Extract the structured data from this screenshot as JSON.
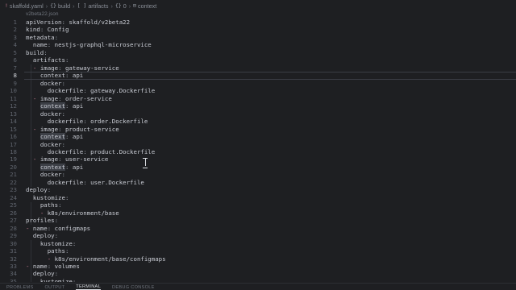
{
  "breadcrumb": [
    {
      "icon": "!",
      "icon_name": "yaml-file-icon",
      "label": "skaffold.yaml"
    },
    {
      "icon": "{}",
      "icon_name": "object-icon",
      "label": "build"
    },
    {
      "icon": "[ ]",
      "icon_name": "array-icon",
      "label": "artifacts"
    },
    {
      "icon": "{}",
      "icon_name": "object-icon",
      "label": "0"
    },
    {
      "icon": "⊟",
      "icon_name": "property-icon",
      "label": "context"
    }
  ],
  "schema_hint": "v2beta22.json",
  "lines": [
    {
      "n": "1",
      "ind": "",
      "dash": "",
      "key": "apiVersion",
      "colon": ":",
      "val": " skaffold/v2beta22"
    },
    {
      "n": "2",
      "ind": "",
      "dash": "",
      "key": "kind",
      "colon": ":",
      "val": " Config"
    },
    {
      "n": "3",
      "ind": "",
      "dash": "",
      "key": "metadata",
      "colon": ":",
      "val": ""
    },
    {
      "n": "4",
      "ind": "  ",
      "dash": "",
      "key": "name",
      "colon": ":",
      "val": " nestjs-graphql-microservice"
    },
    {
      "n": "5",
      "ind": "",
      "dash": "",
      "key": "build",
      "colon": ":",
      "val": ""
    },
    {
      "n": "6",
      "ind": "  ",
      "dash": "",
      "key": "artifacts",
      "colon": ":",
      "val": ""
    },
    {
      "n": "7",
      "ind": "  ",
      "dash": "- ",
      "key": "image",
      "colon": ":",
      "val": " gateway-service"
    },
    {
      "n": "8",
      "ind": "    ",
      "dash": "",
      "key": "context",
      "colon": ":",
      "val": " api",
      "current": true
    },
    {
      "n": "9",
      "ind": "    ",
      "dash": "",
      "key": "docker",
      "colon": ":",
      "val": ""
    },
    {
      "n": "10",
      "ind": "      ",
      "dash": "",
      "key": "dockerfile",
      "colon": ":",
      "val": " gateway.Dockerfile"
    },
    {
      "n": "11",
      "ind": "  ",
      "dash": "- ",
      "key": "image",
      "colon": ":",
      "val": " order-service"
    },
    {
      "n": "12",
      "ind": "    ",
      "dash": "",
      "key": "context",
      "colon": ":",
      "val": " api",
      "hl": true
    },
    {
      "n": "13",
      "ind": "    ",
      "dash": "",
      "key": "docker",
      "colon": ":",
      "val": ""
    },
    {
      "n": "14",
      "ind": "      ",
      "dash": "",
      "key": "dockerfile",
      "colon": ":",
      "val": " order.Dockerfile"
    },
    {
      "n": "15",
      "ind": "  ",
      "dash": "- ",
      "key": "image",
      "colon": ":",
      "val": " product-service"
    },
    {
      "n": "16",
      "ind": "    ",
      "dash": "",
      "key": "context",
      "colon": ":",
      "val": " api",
      "hl": true
    },
    {
      "n": "17",
      "ind": "    ",
      "dash": "",
      "key": "docker",
      "colon": ":",
      "val": ""
    },
    {
      "n": "18",
      "ind": "      ",
      "dash": "",
      "key": "dockerfile",
      "colon": ":",
      "val": " product.Dockerfile"
    },
    {
      "n": "19",
      "ind": "  ",
      "dash": "- ",
      "key": "image",
      "colon": ":",
      "val": " user-service"
    },
    {
      "n": "20",
      "ind": "    ",
      "dash": "",
      "key": "context",
      "colon": ":",
      "val": " api",
      "hl": true
    },
    {
      "n": "21",
      "ind": "    ",
      "dash": "",
      "key": "docker",
      "colon": ":",
      "val": ""
    },
    {
      "n": "22",
      "ind": "      ",
      "dash": "",
      "key": "dockerfile",
      "colon": ":",
      "val": " user.Dockerfile"
    },
    {
      "n": "23",
      "ind": "",
      "dash": "",
      "key": "deploy",
      "colon": ":",
      "val": ""
    },
    {
      "n": "24",
      "ind": "  ",
      "dash": "",
      "key": "kustomize",
      "colon": ":",
      "val": ""
    },
    {
      "n": "25",
      "ind": "    ",
      "dash": "",
      "key": "paths",
      "colon": ":",
      "val": ""
    },
    {
      "n": "26",
      "ind": "    ",
      "dash": "- ",
      "key": "",
      "colon": "",
      "val": "k8s/environment/base"
    },
    {
      "n": "27",
      "ind": "",
      "dash": "",
      "key": "profiles",
      "colon": ":",
      "val": ""
    },
    {
      "n": "28",
      "ind": "",
      "dash": "- ",
      "key": "name",
      "colon": ":",
      "val": " configmaps"
    },
    {
      "n": "29",
      "ind": "  ",
      "dash": "",
      "key": "deploy",
      "colon": ":",
      "val": ""
    },
    {
      "n": "30",
      "ind": "    ",
      "dash": "",
      "key": "kustomize",
      "colon": ":",
      "val": ""
    },
    {
      "n": "31",
      "ind": "      ",
      "dash": "",
      "key": "paths",
      "colon": ":",
      "val": ""
    },
    {
      "n": "32",
      "ind": "      ",
      "dash": "- ",
      "key": "",
      "colon": "",
      "val": "k8s/environment/base/configmaps"
    },
    {
      "n": "33",
      "ind": "",
      "dash": "- ",
      "key": "name",
      "colon": ":",
      "val": " volumes"
    },
    {
      "n": "34",
      "ind": "  ",
      "dash": "",
      "key": "deploy",
      "colon": ":",
      "val": ""
    },
    {
      "n": "35",
      "ind": "    ",
      "dash": "",
      "key": "kustomize",
      "colon": ":",
      "val": ""
    }
  ],
  "panel_tabs": [
    {
      "label": "PROBLEMS",
      "active": false
    },
    {
      "label": "OUTPUT",
      "active": false
    },
    {
      "label": "TERMINAL",
      "active": true
    },
    {
      "label": "DEBUG CONSOLE",
      "active": false
    }
  ],
  "colors": {
    "background": "#1e1f22",
    "dash": "#c27b8f",
    "line_number": "#5f646d",
    "text": "#c9ccd4"
  }
}
